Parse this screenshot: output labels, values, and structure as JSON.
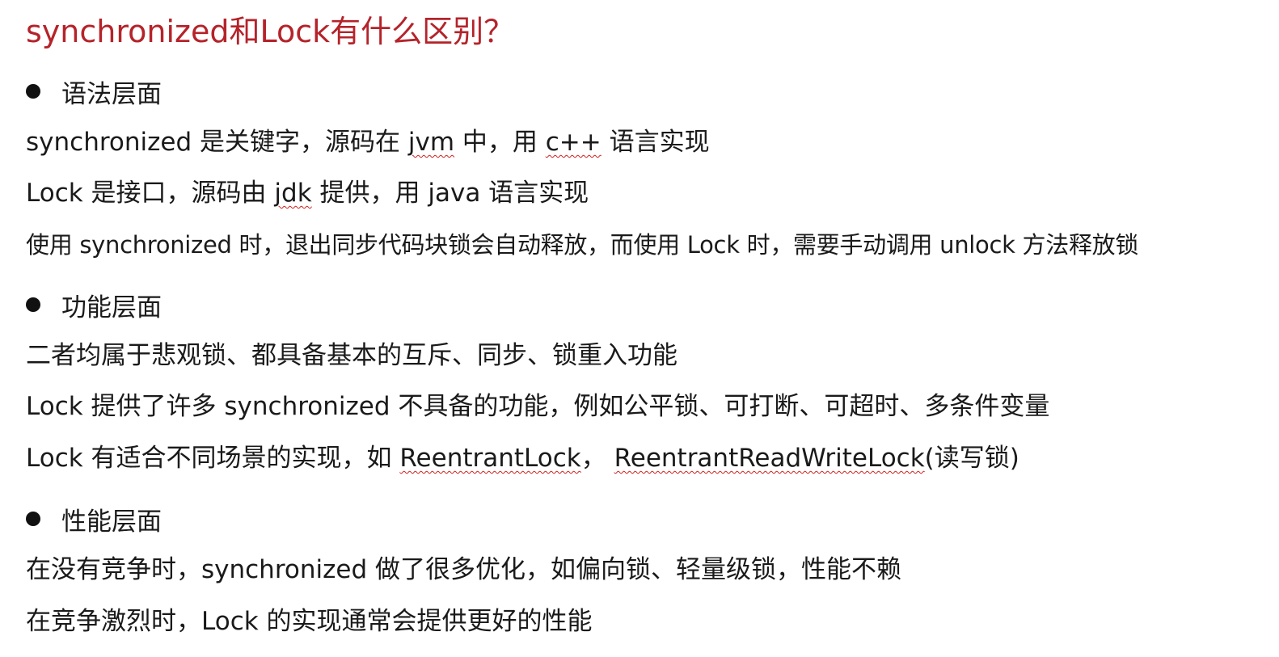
{
  "title": "synchronized和Lock有什么区别？",
  "sections": [
    {
      "heading": "语法层面",
      "lines": [
        {
          "parts": [
            "synchronized 是关键字，源码在 ",
            "jvm",
            " 中，用 ",
            "c++",
            " 语言实现"
          ]
        },
        {
          "parts": [
            "Lock 是接口，源码由 ",
            "jdk",
            " 提供，用 java 语言实现"
          ]
        },
        {
          "parts": [
            "使用 synchronized 时，退出同步代码块锁会自动释放，而使用 Lock 时，需要手动调用 unlock 方法释放锁"
          ]
        }
      ]
    },
    {
      "heading": "功能层面",
      "lines": [
        {
          "parts": [
            "二者均属于悲观锁、都具备基本的互斥、同步、锁重入功能"
          ]
        },
        {
          "parts": [
            "Lock 提供了许多 synchronized 不具备的功能，例如公平锁、可打断、可超时、多条件变量"
          ]
        },
        {
          "parts": [
            "Lock 有适合不同场景的实现，如 ",
            "ReentrantLock",
            "， ",
            "ReentrantReadWriteLock",
            "(读写锁)"
          ]
        }
      ]
    },
    {
      "heading": "性能层面",
      "lines": [
        {
          "parts": [
            "在没有竞争时，synchronized 做了很多优化，如偏向锁、轻量级锁，性能不赖"
          ]
        },
        {
          "parts": [
            "在竞争激烈时，Lock 的实现通常会提供更好的性能"
          ]
        }
      ]
    }
  ],
  "colors": {
    "title": "#b5232a",
    "text": "#1a1a1a",
    "spellcheck_underline": "#d02020"
  },
  "icons": {
    "bullet": "bullet-dot-icon"
  }
}
